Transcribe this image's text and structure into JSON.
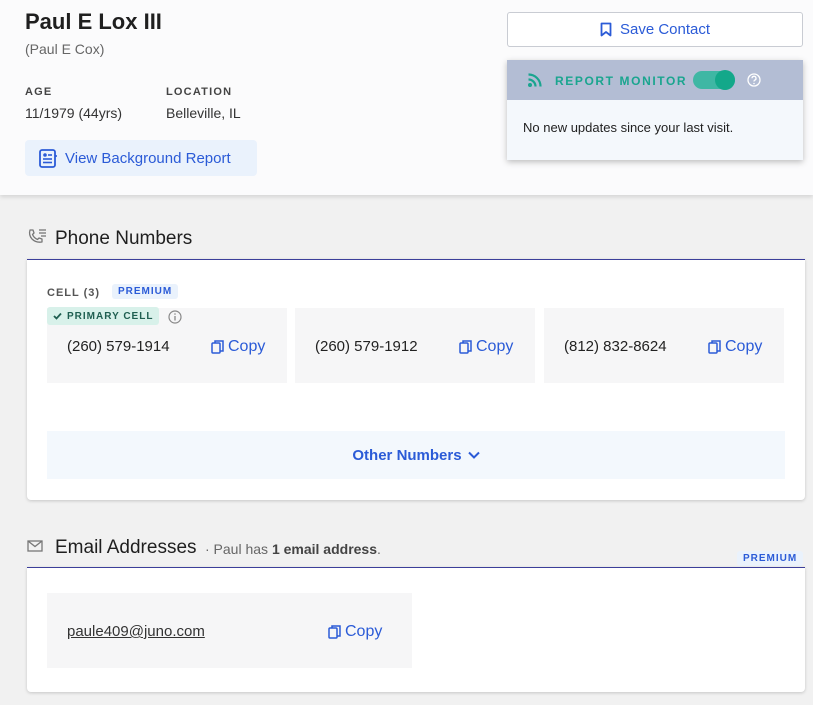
{
  "profile": {
    "name": "Paul E Lox III",
    "alias": "(Paul E Cox)",
    "age_label": "AGE",
    "age_value": "11/1979 (44yrs)",
    "location_label": "LOCATION",
    "location_value": "Belleville, IL",
    "view_report_label": "View Background Report"
  },
  "save_contact_label": "Save Contact",
  "monitor": {
    "title": "REPORT MONITOR",
    "enabled": true,
    "message": "No new updates since your last visit."
  },
  "phones": {
    "heading": "Phone Numbers",
    "cell_label": "CELL (3)",
    "premium_badge": "PREMIUM",
    "primary_badge": "PRIMARY CELL",
    "copy_label": "Copy",
    "numbers": [
      "(260) 579-1914",
      "(260) 579-1912",
      "(812) 832-8624"
    ],
    "other_numbers_label": "Other Numbers"
  },
  "emails": {
    "heading": "Email Addresses",
    "sub_prefix": "· Paul has",
    "sub_count": "1 email address",
    "sub_suffix": ".",
    "premium_badge": "PREMIUM",
    "address": "paule409@juno.com",
    "copy_label": "Copy"
  },
  "colors": {
    "accent": "#2b5bd7",
    "monitor_bar": "#b3bdd4",
    "toggle_on": "#3fb7a4",
    "section_rule": "#3c3f9a"
  }
}
